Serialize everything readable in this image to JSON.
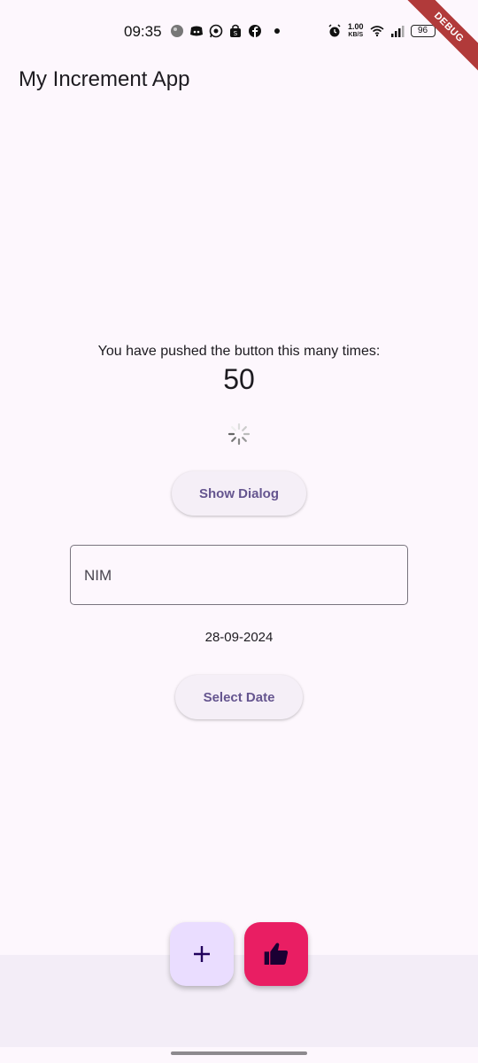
{
  "status_bar": {
    "time": "09:35",
    "left_icons": [
      "gallery-icon",
      "discord-icon",
      "whatsapp-icon",
      "shopping-bag-icon",
      "facebook-icon"
    ],
    "net_speed_value": "1.00",
    "net_speed_unit": "KB/S",
    "battery": "96"
  },
  "debug_banner": "DEBUG",
  "app_bar": {
    "title": "My Increment App"
  },
  "counter": {
    "caption": "You have pushed the button this many times:",
    "value": "50"
  },
  "buttons": {
    "show_dialog": "Show Dialog",
    "select_date": "Select Date"
  },
  "nim_field": {
    "label": "NIM",
    "value": ""
  },
  "selected_date": "28-09-2024",
  "fabs": {
    "increment_icon": "plus-icon",
    "like_icon": "thumbs-up-icon"
  },
  "colors": {
    "background": "#fdf7fd",
    "accent": "#65558f",
    "fab_add": "#eaddff",
    "fab_like": "#e91e63",
    "bottom_bar": "#f3edf7"
  }
}
